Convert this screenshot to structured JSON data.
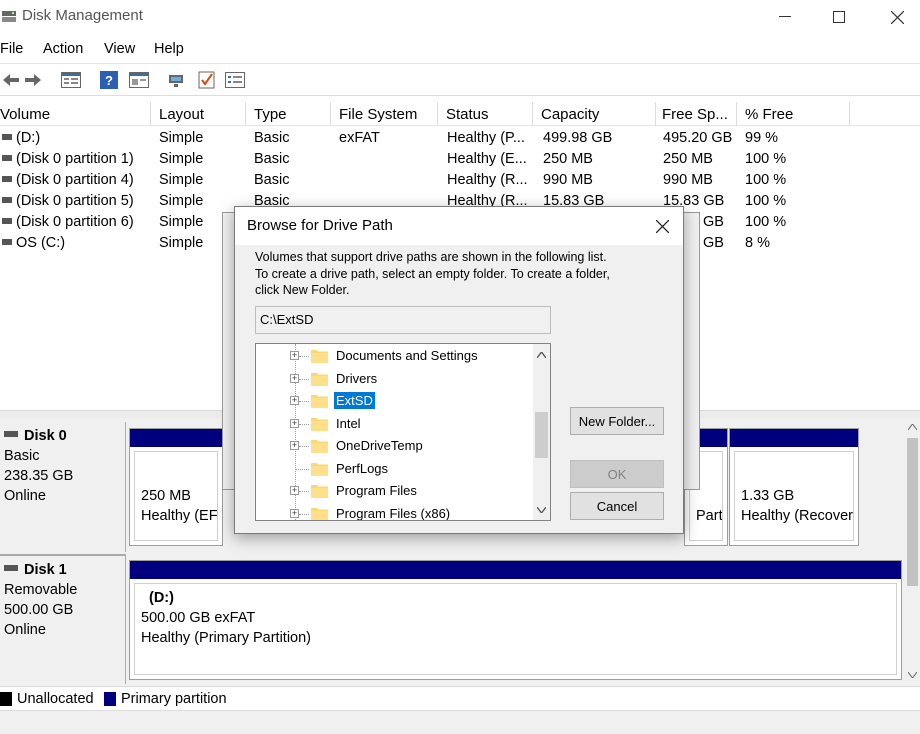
{
  "window": {
    "title": "Disk Management"
  },
  "menu": [
    "File",
    "Action",
    "View",
    "Help"
  ],
  "toolbar_icons": [
    "back-icon",
    "forward-icon",
    "list-view-icon",
    "help-icon",
    "properties-icon",
    "connect-icon",
    "check-icon",
    "settings-icon"
  ],
  "list": {
    "columns": [
      "Volume",
      "Layout",
      "Type",
      "File System",
      "Status",
      "Capacity",
      "Free Sp...",
      "% Free"
    ],
    "rows": [
      {
        "volume": "(D:)",
        "layout": "Simple",
        "type": "Basic",
        "fs": "exFAT",
        "status": "Healthy (P...",
        "capacity": "499.98 GB",
        "free": "495.20 GB",
        "pct": "99 %"
      },
      {
        "volume": "(Disk 0 partition 1)",
        "layout": "Simple",
        "type": "Basic",
        "fs": "",
        "status": "Healthy (E...",
        "capacity": "250 MB",
        "free": "250 MB",
        "pct": "100 %"
      },
      {
        "volume": "(Disk 0 partition 4)",
        "layout": "Simple",
        "type": "Basic",
        "fs": "",
        "status": "Healthy (R...",
        "capacity": "990 MB",
        "free": "990 MB",
        "pct": "100 %"
      },
      {
        "volume": "(Disk 0 partition 5)",
        "layout": "Simple",
        "type": "Basic",
        "fs": "",
        "status": "Healthy (R...",
        "capacity": "15.83 GB",
        "free": "15.83 GB",
        "pct": "100 %"
      },
      {
        "volume": "(Disk 0 partition 6)",
        "layout": "Simple",
        "type": "",
        "fs": "",
        "status": "",
        "capacity": "",
        "free": "GB",
        "pct": "100 %"
      },
      {
        "volume": "OS (C:)",
        "layout": "Simple",
        "type": "",
        "fs": "",
        "status": "",
        "capacity": "",
        "free": "GB",
        "pct": "8 %"
      }
    ]
  },
  "disks": [
    {
      "name": "Disk 0",
      "kind": "Basic",
      "size": "238.35 GB",
      "state": "Online",
      "partitions": [
        {
          "size": "250 MB",
          "status": "Healthy (EF"
        },
        {
          "size": "",
          "status": "Part"
        },
        {
          "size": "1.33 GB",
          "status": "Healthy (Recover"
        }
      ]
    },
    {
      "name": "Disk 1",
      "kind": "Removable",
      "size": "500.00 GB",
      "state": "Online",
      "partitions": [
        {
          "label": "(D:)",
          "size": "500.00 GB exFAT",
          "status": "Healthy (Primary Partition)"
        }
      ]
    }
  ],
  "legend": [
    {
      "label": "Unallocated",
      "color": "#000000"
    },
    {
      "label": "Primary partition",
      "color": "#00007f"
    }
  ],
  "dialog": {
    "title": "Browse for Drive Path",
    "description_lines": [
      "Volumes that support drive paths are shown in the following list.",
      "To create a drive path, select an empty folder. To create a folder,",
      "click New Folder."
    ],
    "path": "C:\\ExtSD",
    "folders": [
      "Documents and Settings",
      "Drivers",
      "ExtSD",
      "Intel",
      "OneDriveTemp",
      "PerfLogs",
      "Program Files",
      "Program Files (x86)"
    ],
    "selected_folder": "ExtSD",
    "buttons": {
      "new_folder": "New Folder...",
      "ok": "OK",
      "cancel": "Cancel"
    }
  }
}
